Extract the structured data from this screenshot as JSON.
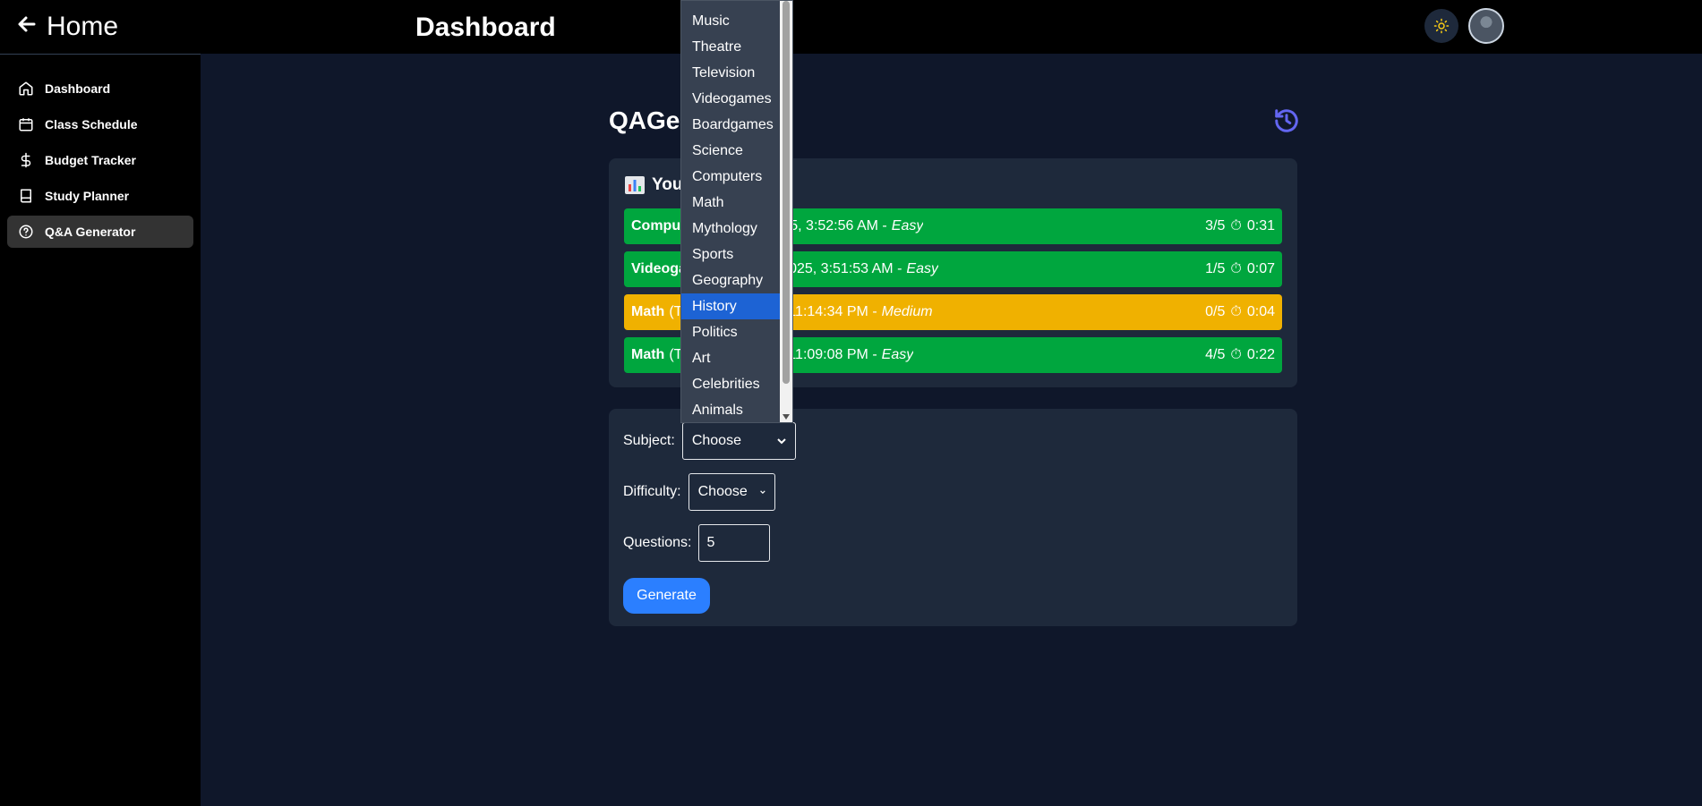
{
  "header": {
    "home_label": "Home",
    "title": "Dashboard",
    "theme_icon": "sun-icon",
    "accent_sun": "#facc15"
  },
  "sidebar": {
    "items": [
      {
        "label": "Dashboard",
        "icon": "home-icon"
      },
      {
        "label": "Class Schedule",
        "icon": "calendar-icon"
      },
      {
        "label": "Budget Tracker",
        "icon": "dollar-icon"
      },
      {
        "label": "Study Planner",
        "icon": "book-icon"
      },
      {
        "label": "Q&A Generator",
        "icon": "help-circle-icon",
        "active": true
      }
    ]
  },
  "main": {
    "title": "QAGe",
    "history_icon_color": "#6366f1",
    "results": {
      "title": "You",
      "rows": [
        {
          "subject": "Compu",
          "detail": "/2025, 3:52:56 AM -",
          "difficulty": "Easy",
          "score": "3/5",
          "time": "0:31",
          "color": "#00a63e"
        },
        {
          "subject": "Videoga",
          "detail": "31/2025, 3:51:53 AM -",
          "difficulty": "Easy",
          "score": "1/5",
          "time": "0:07",
          "color": "#00a63e"
        },
        {
          "subject": "Math",
          "detail": "(T",
          "detail2": ", 11:14:34 PM -",
          "difficulty": "Medium",
          "score": "0/5",
          "time": "0:04",
          "color": "#f0b100"
        },
        {
          "subject": "Math",
          "detail": "(T",
          "detail2": ", 11:09:08 PM -",
          "difficulty": "Easy",
          "score": "4/5",
          "time": "0:22",
          "color": "#00a63e"
        }
      ]
    },
    "form": {
      "subject_label": "Subject:",
      "subject_value": "Choose",
      "difficulty_label": "Difficulty:",
      "difficulty_value": "Choose",
      "questions_label": "Questions:",
      "questions_value": "5",
      "generate_label": "Generate"
    },
    "dropdown": {
      "options": [
        "Music",
        "Theatre",
        "Television",
        "Videogames",
        "Boardgames",
        "Science",
        "Computers",
        "Math",
        "Mythology",
        "Sports",
        "Geography",
        "History",
        "Politics",
        "Art",
        "Celebrities",
        "Animals"
      ],
      "highlighted": "History"
    }
  }
}
